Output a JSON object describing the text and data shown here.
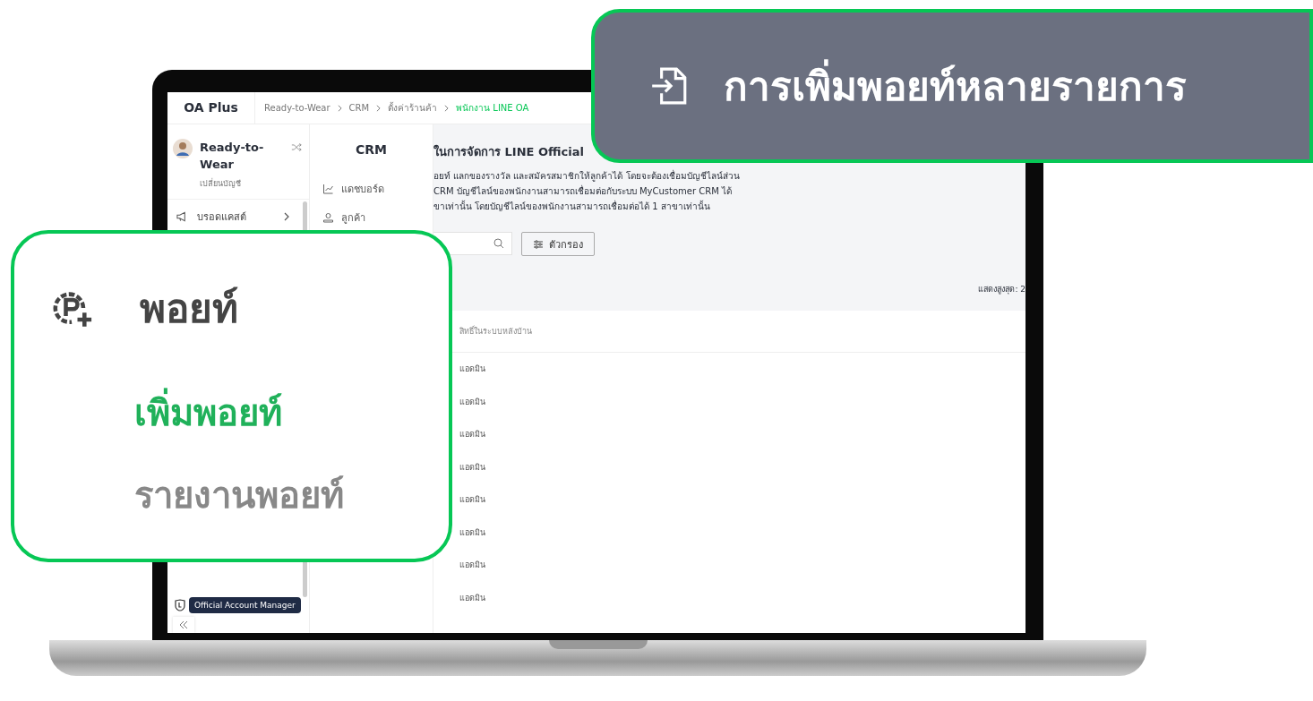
{
  "app": {
    "logo": "OA Plus",
    "breadcrumb": [
      {
        "label": "Ready-to-Wear",
        "selected": false
      },
      {
        "label": "CRM",
        "selected": false
      },
      {
        "label": "ตั้งค่าร้านค้า",
        "selected": false
      },
      {
        "label": "พนักงาน LINE OA",
        "selected": true
      }
    ],
    "account": {
      "name": "Ready-to-Wear",
      "switch_label": "เปลี่ยนบัญชี"
    },
    "sidebar": {
      "items": [
        {
          "label": "บรอดแคสต์"
        }
      ]
    },
    "tooltip": "Official Account Manager",
    "submenu": {
      "title": "CRM",
      "items": [
        {
          "label": "แดชบอร์ด",
          "kind": "chart"
        },
        {
          "label": "ลูกค้า",
          "kind": "user"
        }
      ]
    },
    "page": {
      "title": "ในการจัดการ LINE Official",
      "description": [
        "อยท์ แลกของรางวัล และสมัครสมาชิกให้ลูกค้าได้ โดยจะต้องเชื่อมบัญชีไลน์ส่วน",
        "CRM บัญชีไลน์ของพนักงานสามารถเชื่อมต่อกับระบบ MyCustomer CRM ได้",
        "ขาเท่านั้น โดยบัญชีไลน์ของพนักงานสามารถเชื่อมต่อได้ 1 สาขาเท่านั้น"
      ],
      "filter_button": "ตัวกรอง",
      "max_display": "แสดงสูงสุด: 2",
      "table": {
        "columns": [
          "สิทธิ์ในระบบหลังบ้าน"
        ],
        "rows": [
          [
            "แอดมิน"
          ],
          [
            "แอดมิน"
          ],
          [
            "แอดมิน"
          ],
          [
            "แอดมิน"
          ],
          [
            "แอดมิน"
          ],
          [
            "แอดมิน"
          ],
          [
            "แอดมิน"
          ],
          [
            "แอดมิน"
          ]
        ]
      }
    }
  },
  "point_menu_callout": {
    "title": "พอยท์",
    "items": [
      {
        "label": "เพิ่มพอยท์",
        "selected": true
      },
      {
        "label": "รายงานพอยท์",
        "selected": false
      }
    ]
  },
  "import_callout": {
    "label": "การเพิ่มพอยท์หลายรายการ"
  }
}
